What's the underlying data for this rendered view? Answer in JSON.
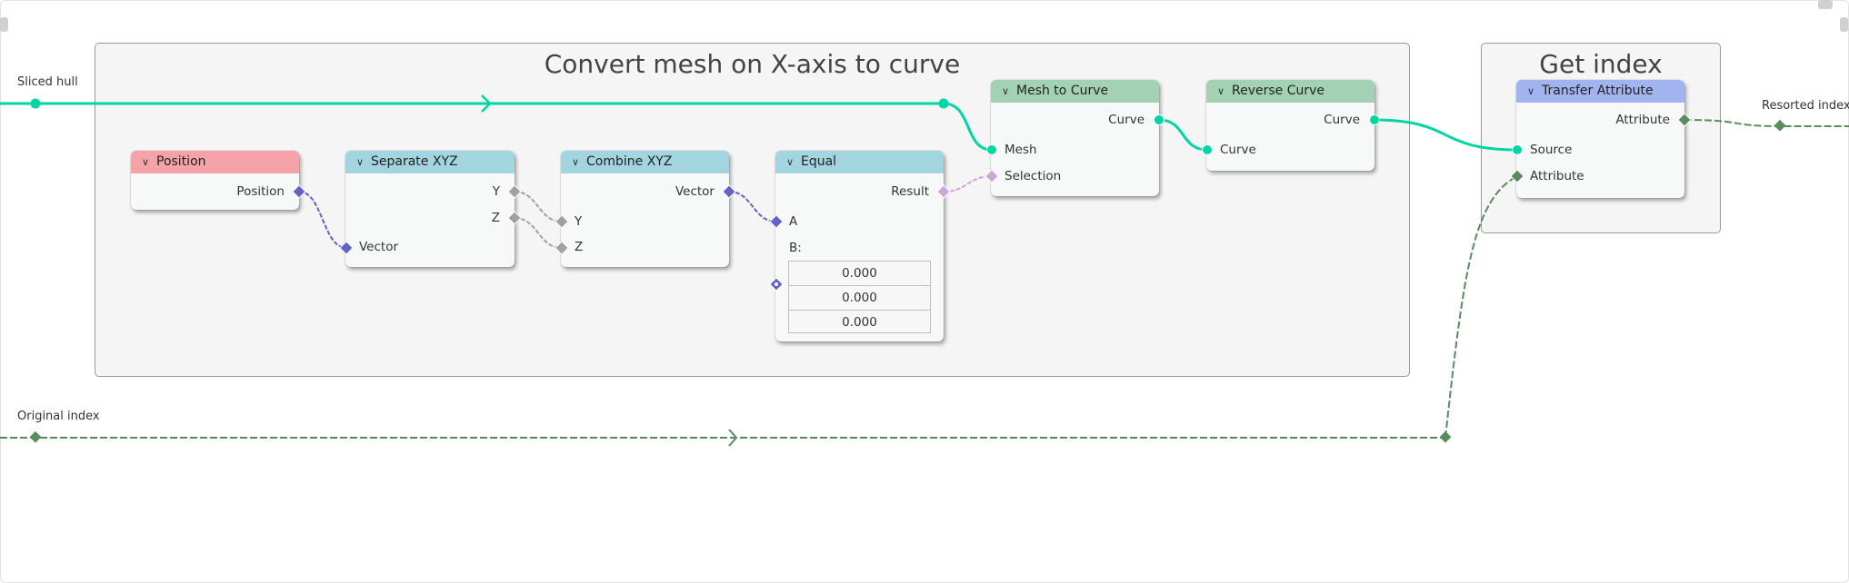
{
  "editor": "Geometry Node Editor",
  "colors": {
    "geometry_socket": "#00d6a3",
    "vector_socket": "#6363c7",
    "float_socket": "#a1a1a1",
    "boolean_socket": "#cca6d6",
    "integer_socket": "#598c5c",
    "input_header": "#f5a3a8",
    "converter_header": "#a3d5e0",
    "geometry_header": "#a2d2b3",
    "attribute_header": "#a2b4ef",
    "frame_bg": "#f5f5f5"
  },
  "frames": [
    {
      "id": "frame-convert",
      "title": "Convert mesh on X-axis to curve"
    },
    {
      "id": "frame-index",
      "title": "Get index"
    }
  ],
  "reroutes": [
    {
      "id": "sliced-hull",
      "label": "Sliced hull",
      "type": "geometry"
    },
    {
      "id": "original-index",
      "label": "Original index",
      "type": "integer"
    },
    {
      "id": "resorted-index",
      "label": "Resorted index",
      "type": "integer"
    }
  ],
  "nodes": {
    "position": {
      "title": "Position",
      "outputs": [
        "Position"
      ],
      "inputs": []
    },
    "separate_xyz": {
      "title": "Separate XYZ",
      "outputs": [
        "Y",
        "Z"
      ],
      "inputs": [
        "Vector"
      ]
    },
    "combine_xyz": {
      "title": "Combine XYZ",
      "outputs": [
        "Vector"
      ],
      "inputs": [
        "Y",
        "Z"
      ]
    },
    "equal": {
      "title": "Equal",
      "outputs": [
        "Result"
      ],
      "inputs": [
        "A"
      ],
      "b_label": "B:",
      "b_values": [
        "0.000",
        "0.000",
        "0.000"
      ]
    },
    "mesh_to_curve": {
      "title": "Mesh to Curve",
      "outputs": [
        "Curve"
      ],
      "inputs": [
        "Mesh",
        "Selection"
      ]
    },
    "reverse_curve": {
      "title": "Reverse Curve",
      "outputs": [
        "Curve"
      ],
      "inputs": [
        "Curve"
      ]
    },
    "transfer_attribute": {
      "title": "Transfer Attribute",
      "outputs": [
        "Attribute"
      ],
      "inputs": [
        "Source",
        "Attribute"
      ]
    }
  },
  "icons": {
    "collapse": "chevron-down"
  }
}
